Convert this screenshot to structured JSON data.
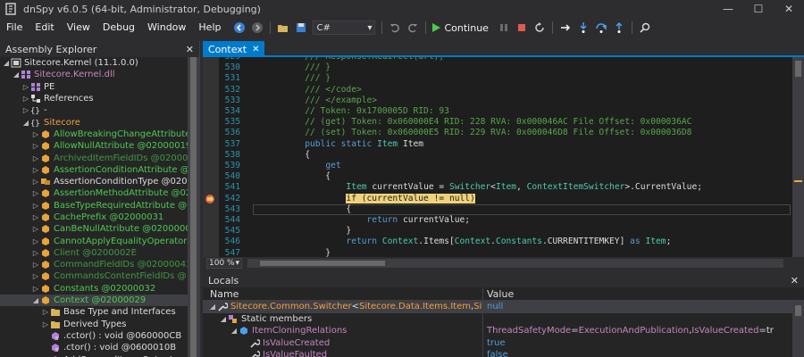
{
  "window": {
    "title": "dnSpy v6.0.5 (64-bit, Administrator, Debugging)",
    "minimize": "—",
    "maximize": "☐",
    "close": "✕"
  },
  "menu": [
    "File",
    "Edit",
    "View",
    "Debug",
    "Window",
    "Help"
  ],
  "toolbar": {
    "language": "C#",
    "continue_label": "Continue"
  },
  "assembly_explorer": {
    "title": "Assembly Explorer",
    "close": "✕",
    "items": [
      {
        "indent": 0,
        "twisty": "◢",
        "icon": "assembly-icon",
        "label": "Sitecore.Kernel (11.1.0.0)",
        "color": "#dcdcdc"
      },
      {
        "indent": 1,
        "twisty": "◢",
        "icon": "module-icon",
        "label": "Sitecore.Kernel.dll",
        "color": "#c586c0"
      },
      {
        "indent": 2,
        "twisty": "▷",
        "icon": "pe-icon",
        "label": "PE",
        "color": "#dcdcdc"
      },
      {
        "indent": 2,
        "twisty": "▷",
        "icon": "references-icon",
        "label": "References",
        "color": "#dcdcdc"
      },
      {
        "indent": 2,
        "twisty": "▷",
        "icon": "namespace-icon",
        "label": "-",
        "color": "#dcdcdc"
      },
      {
        "indent": 2,
        "twisty": "◢",
        "icon": "namespace-icon",
        "label": "Sitecore",
        "color": "#f0a03c"
      },
      {
        "indent": 3,
        "twisty": "▷",
        "icon": "class-icon",
        "label": "AllowBreakingChangeAttribute @",
        "color": "#4ec94e"
      },
      {
        "indent": 3,
        "twisty": "▷",
        "icon": "class-icon",
        "label": "AllowNullAttribute @02000019",
        "color": "#4ec94e"
      },
      {
        "indent": 3,
        "twisty": "▷",
        "icon": "class-icon",
        "label": "ArchivedItemFieldIDs @0200004",
        "color": "#3e9a3e"
      },
      {
        "indent": 3,
        "twisty": "▷",
        "icon": "class-icon",
        "label": "AssertionConditionAttribute @0",
        "color": "#4ec94e"
      },
      {
        "indent": 3,
        "twisty": "▷",
        "icon": "enum-icon",
        "label": "AssertionConditionType @020000",
        "color": "#dcdcdc"
      },
      {
        "indent": 3,
        "twisty": "▷",
        "icon": "class-icon",
        "label": "AssertionMethodAttribute @020",
        "color": "#4ec94e"
      },
      {
        "indent": 3,
        "twisty": "▷",
        "icon": "class-icon",
        "label": "BaseTypeRequiredAttribute @02",
        "color": "#4ec94e"
      },
      {
        "indent": 3,
        "twisty": "▷",
        "icon": "class-icon",
        "label": "CachePrefix @02000031",
        "color": "#4ec94e"
      },
      {
        "indent": 3,
        "twisty": "▷",
        "icon": "class-icon",
        "label": "CanBeNullAttribute @02000002D",
        "color": "#4ec94e"
      },
      {
        "indent": 3,
        "twisty": "▷",
        "icon": "class-icon",
        "label": "CannotApplyEqualityOperatorAt",
        "color": "#4ec94e"
      },
      {
        "indent": 3,
        "twisty": "▷",
        "icon": "class-icon",
        "label": "Client @0200002E",
        "color": "#3e9a3e"
      },
      {
        "indent": 3,
        "twisty": "▷",
        "icon": "class-icon",
        "label": "CommandFieldIDs @02000043",
        "color": "#3e9a3e"
      },
      {
        "indent": 3,
        "twisty": "▷",
        "icon": "class-icon",
        "label": "CommandsContentFieldIDs @",
        "color": "#3e9a3e"
      },
      {
        "indent": 3,
        "twisty": "▷",
        "icon": "class-icon",
        "label": "Constants @02000032",
        "color": "#4ec94e"
      },
      {
        "indent": 3,
        "twisty": "◢",
        "icon": "class-icon",
        "label": "Context @02000029",
        "color": "#4ec94e",
        "selected": true
      },
      {
        "indent": 4,
        "twisty": "▷",
        "icon": "folder-icon",
        "label": "Base Type and Interfaces",
        "color": "#dcdcdc"
      },
      {
        "indent": 4,
        "twisty": "▷",
        "icon": "folder-icon",
        "label": "Derived Types",
        "color": "#dcdcdc"
      },
      {
        "indent": 4,
        "twisty": "",
        "icon": "method-icon",
        "label": ".cctor() : void @060000CB",
        "color": "#dcdcdc"
      },
      {
        "indent": 4,
        "twisty": "",
        "icon": "method-icon",
        "label": ".ctor() : void @0600010B",
        "color": "#dcdcdc"
      },
      {
        "indent": 4,
        "twisty": "",
        "icon": "method-icon",
        "label": "AddSecuredItemsOutput",
        "color": "#dcdcdc"
      }
    ]
  },
  "editor": {
    "tab_label": "Context",
    "tab_close": "✕",
    "zoom": "100 %",
    "lines": [
      {
        "num": "529",
        "segs": [
          {
            "t": "        /// Response.Redirect(url);",
            "c": "#57a64a"
          }
        ]
      },
      {
        "num": "530",
        "segs": [
          {
            "t": "        /// }",
            "c": "#57a64a"
          }
        ]
      },
      {
        "num": "531",
        "segs": [
          {
            "t": "        /// }",
            "c": "#57a64a"
          }
        ]
      },
      {
        "num": "532",
        "segs": [
          {
            "t": "        /// </code>",
            "c": "#57a64a"
          }
        ]
      },
      {
        "num": "533",
        "segs": [
          {
            "t": "        /// </example>",
            "c": "#57a64a"
          }
        ]
      },
      {
        "num": "534",
        "segs": [
          {
            "t": "        // Token: 0x1700005D RID: 93",
            "c": "#57a64a"
          }
        ]
      },
      {
        "num": "535",
        "segs": [
          {
            "t": "        // (get) Token: 0x060000E4 RID: 228 RVA: 0x000046AC File Offset: 0x000036AC",
            "c": "#57a64a"
          }
        ]
      },
      {
        "num": "536",
        "segs": [
          {
            "t": "        // (set) Token: 0x060000E5 RID: 229 RVA: 0x000046D8 File Offset: 0x000036D8",
            "c": "#57a64a"
          }
        ]
      },
      {
        "num": "537",
        "segs": [
          {
            "t": "        ",
            "c": "#dcdcdc"
          },
          {
            "t": "public static ",
            "c": "#569cd6"
          },
          {
            "t": "Item ",
            "c": "#4ec9b0"
          },
          {
            "t": "Item",
            "c": "#dcdcdc"
          }
        ]
      },
      {
        "num": "538",
        "segs": [
          {
            "t": "        {",
            "c": "#dcdcdc"
          }
        ]
      },
      {
        "num": "539",
        "segs": [
          {
            "t": "            ",
            "c": "#dcdcdc"
          },
          {
            "t": "get",
            "c": "#569cd6"
          }
        ]
      },
      {
        "num": "540",
        "segs": [
          {
            "t": "            {",
            "c": "#dcdcdc"
          }
        ]
      },
      {
        "num": "541",
        "segs": [
          {
            "t": "                ",
            "c": "#dcdcdc"
          },
          {
            "t": "Item ",
            "c": "#4ec9b0"
          },
          {
            "t": "currentValue = ",
            "c": "#dcdcdc"
          },
          {
            "t": "Switcher",
            "c": "#4ec9b0"
          },
          {
            "t": "<",
            "c": "#dcdcdc"
          },
          {
            "t": "Item",
            "c": "#4ec9b0"
          },
          {
            "t": ", ",
            "c": "#dcdcdc"
          },
          {
            "t": "ContextItemSwitcher",
            "c": "#4ec9b0"
          },
          {
            "t": ">.CurrentValue;",
            "c": "#dcdcdc"
          }
        ]
      },
      {
        "num": "542",
        "segs": [
          {
            "t": "                ",
            "c": "#dcdcdc"
          },
          {
            "t": "if (currentValue != null)",
            "c": "#1e1e1e",
            "hl": true
          }
        ],
        "breakpoint": true
      },
      {
        "num": "543",
        "segs": [
          {
            "t": "                {",
            "c": "#dcdcdc"
          }
        ],
        "current": true
      },
      {
        "num": "544",
        "segs": [
          {
            "t": "                    ",
            "c": "#dcdcdc"
          },
          {
            "t": "return ",
            "c": "#569cd6"
          },
          {
            "t": "currentValue;",
            "c": "#dcdcdc"
          }
        ]
      },
      {
        "num": "545",
        "segs": [
          {
            "t": "                }",
            "c": "#dcdcdc"
          }
        ]
      },
      {
        "num": "546",
        "segs": [
          {
            "t": "                ",
            "c": "#dcdcdc"
          },
          {
            "t": "return ",
            "c": "#569cd6"
          },
          {
            "t": "Context",
            "c": "#4ec9b0"
          },
          {
            "t": ".Items[",
            "c": "#dcdcdc"
          },
          {
            "t": "Context",
            "c": "#4ec9b0"
          },
          {
            "t": ".",
            "c": "#dcdcdc"
          },
          {
            "t": "Constants",
            "c": "#4ec9b0"
          },
          {
            "t": ".CURRENTITEMKEY] ",
            "c": "#dcdcdc"
          },
          {
            "t": "as ",
            "c": "#569cd6"
          },
          {
            "t": "Item",
            "c": "#4ec9b0"
          },
          {
            "t": ";",
            "c": "#dcdcdc"
          }
        ]
      },
      {
        "num": "547",
        "segs": [
          {
            "t": "            }",
            "c": "#dcdcdc"
          }
        ]
      }
    ]
  },
  "locals": {
    "title": "Locals",
    "close": "✕",
    "col_name": "Name",
    "col_value": "Value",
    "rows": [
      {
        "indent": 0,
        "twisty": "◢",
        "icon": "wrench-icon",
        "name": [
          {
            "t": "Sitecore.Common.Switcher",
            "c": "#f0a03c"
          },
          {
            "t": "<",
            "c": "#dcdcdc"
          },
          {
            "t": "Sitecore.Data.Items.Item",
            "c": "#f0a03c"
          },
          {
            "t": ", ",
            "c": "#dcdcdc"
          },
          {
            "t": "Sitecore.Da…",
            "c": "#f0a03c"
          }
        ],
        "value": [
          {
            "t": "null",
            "c": "#569cd6"
          }
        ],
        "selected": true
      },
      {
        "indent": 1,
        "twisty": "◢",
        "icon": "static-members-icon",
        "name": [
          {
            "t": "Static members",
            "c": "#dcdcdc"
          }
        ],
        "value": []
      },
      {
        "indent": 2,
        "twisty": "◢",
        "icon": "field-icon",
        "name": [
          {
            "t": "ItemCloningRelations",
            "c": "#c586c0"
          }
        ],
        "value": [
          {
            "t": "ThreadSafetyMode",
            "c": "#c586c0"
          },
          {
            "t": "=",
            "c": "#dcdcdc"
          },
          {
            "t": "ExecutionAndPublication",
            "c": "#c586c0"
          },
          {
            "t": ", ",
            "c": "#dcdcdc"
          },
          {
            "t": "IsValueCreated",
            "c": "#c586c0"
          },
          {
            "t": "=tr",
            "c": "#dcdcdc"
          }
        ]
      },
      {
        "indent": 3,
        "twisty": "",
        "icon": "property-icon",
        "name": [
          {
            "t": "IsValueCreated",
            "c": "#c586c0"
          }
        ],
        "value": [
          {
            "t": "true",
            "c": "#569cd6"
          }
        ]
      },
      {
        "indent": 3,
        "twisty": "",
        "icon": "property-icon",
        "name": [
          {
            "t": "IsValueFaulted",
            "c": "#c586c0"
          }
        ],
        "value": [
          {
            "t": "false",
            "c": "#569cd6"
          }
        ]
      }
    ]
  }
}
